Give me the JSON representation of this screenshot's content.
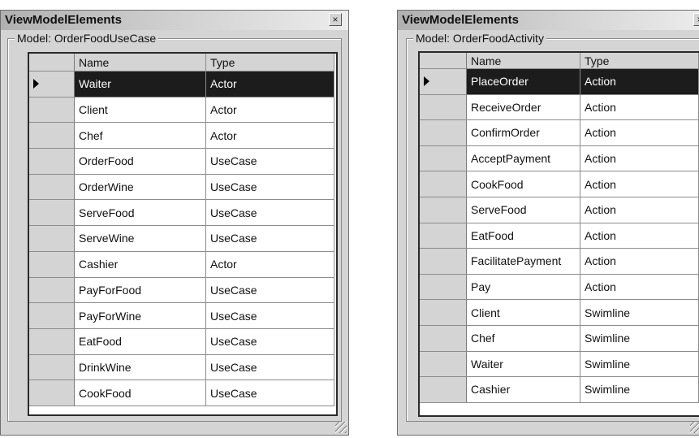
{
  "windows": [
    {
      "title": "ViewModelElements",
      "close_glyph": "×",
      "group_label": "Model: OrderFoodUseCase",
      "columns": [
        "Name",
        "Type"
      ],
      "selected_row": 0,
      "rows": [
        [
          "Waiter",
          "Actor"
        ],
        [
          "Client",
          "Actor"
        ],
        [
          "Chef",
          "Actor"
        ],
        [
          "OrderFood",
          "UseCase"
        ],
        [
          "OrderWine",
          "UseCase"
        ],
        [
          "ServeFood",
          "UseCase"
        ],
        [
          "ServeWine",
          "UseCase"
        ],
        [
          "Cashier",
          "Actor"
        ],
        [
          "PayForFood",
          "UseCase"
        ],
        [
          "PayForWine",
          "UseCase"
        ],
        [
          "EatFood",
          "UseCase"
        ],
        [
          "DrinkWine",
          "UseCase"
        ],
        [
          "CookFood",
          "UseCase"
        ]
      ]
    },
    {
      "title": "ViewModelElements",
      "close_glyph": "×",
      "group_label": "Model: OrderFoodActivity",
      "columns": [
        "Name",
        "Type"
      ],
      "selected_row": 0,
      "rows": [
        [
          "PlaceOrder",
          "Action"
        ],
        [
          "ReceiveOrder",
          "Action"
        ],
        [
          "ConfirmOrder",
          "Action"
        ],
        [
          "AcceptPayment",
          "Action"
        ],
        [
          "CookFood",
          "Action"
        ],
        [
          "ServeFood",
          "Action"
        ],
        [
          "EatFood",
          "Action"
        ],
        [
          "FacilitatePayment",
          "Action"
        ],
        [
          "Pay",
          "Action"
        ],
        [
          "Client",
          "Swimline"
        ],
        [
          "Chef",
          "Swimline"
        ],
        [
          "Waiter",
          "Swimline"
        ],
        [
          "Cashier",
          "Swimline"
        ]
      ]
    }
  ]
}
